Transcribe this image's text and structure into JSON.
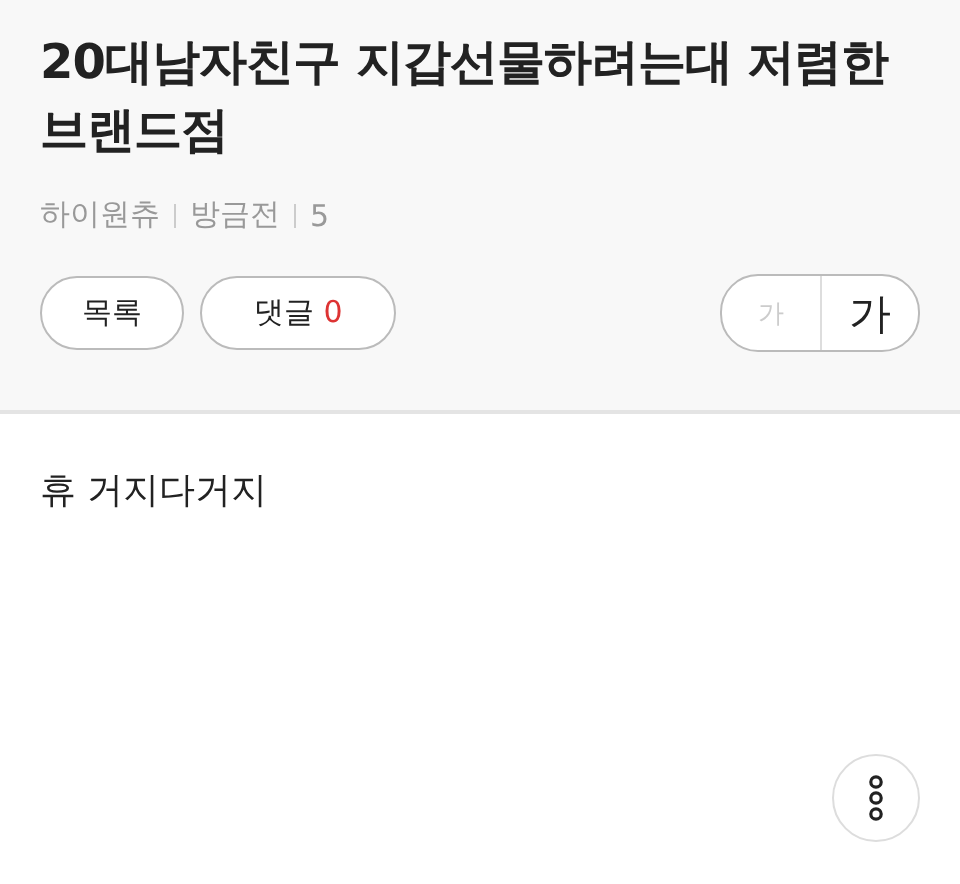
{
  "post": {
    "title": "20대남자친구 지갑선물하려는대 저렴한 브랜드점",
    "meta": [
      "하이원츄",
      "방금전",
      "5"
    ],
    "body": "휴 거지다거지"
  },
  "actions": {
    "list_button": "목록",
    "comments_button": {
      "label": "댓글",
      "count": "0"
    }
  },
  "font_size": [
    {
      "label": "가",
      "kind": "small",
      "disabled": true
    },
    {
      "label": "가",
      "kind": "large",
      "disabled": false
    }
  ]
}
